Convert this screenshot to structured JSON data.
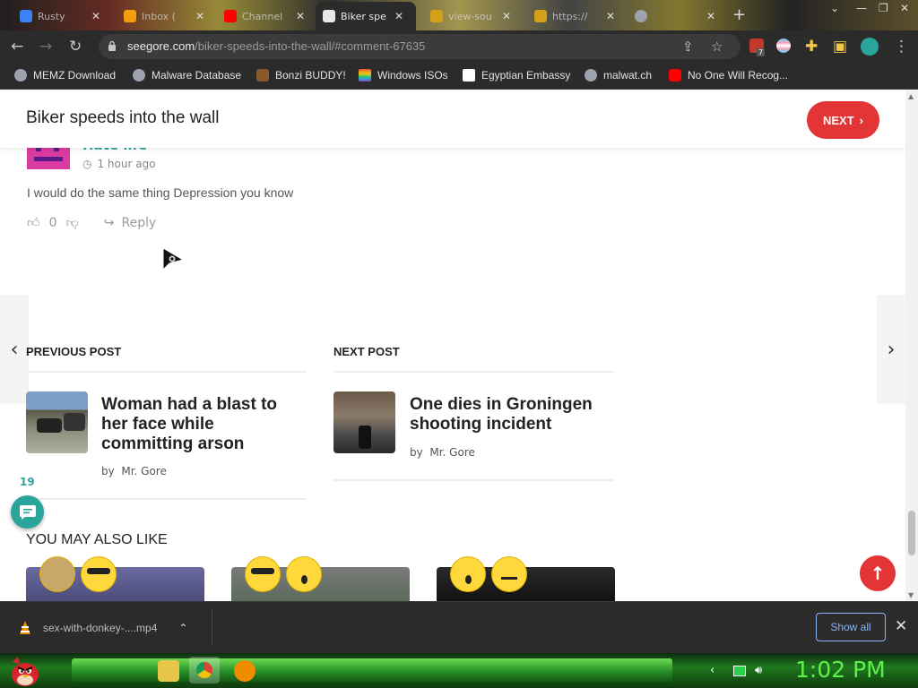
{
  "browser": {
    "tabs": [
      {
        "title": "Rusty",
        "favicon_color": "#3b82f6"
      },
      {
        "title": "Inbox (",
        "favicon_color": "#f59e0b"
      },
      {
        "title": "Channel",
        "favicon_color": "#ff0000"
      },
      {
        "title": "Biker spe",
        "favicon_color": "#e5e7eb",
        "active": true
      },
      {
        "title": "view-sou",
        "favicon_color": "#d4a017"
      },
      {
        "title": "https://",
        "favicon_color": "#d4a017"
      },
      {
        "title": "",
        "favicon_color": "#9ca3af"
      }
    ],
    "new_tab_glyph": "+",
    "url_host": "seegore.com",
    "url_path": "/biker-speeds-into-the-wall/#comment-67635",
    "extension_badge": "7"
  },
  "bookmarks": [
    {
      "label": "MEMZ Download",
      "icon_color": "#9ca3af"
    },
    {
      "label": "Malware Database",
      "icon_color": "#9ca3af"
    },
    {
      "label": "Bonzi BUDDY!",
      "icon_color": "#8b5a2b"
    },
    {
      "label": "Windows ISOs",
      "icon_color": "#e74c3c"
    },
    {
      "label": "Egyptian Embassy",
      "icon_color": "#ffffff"
    },
    {
      "label": "malwat.ch",
      "icon_color": "#9ca3af"
    },
    {
      "label": "No One Will Recog...",
      "icon_color": "#ff0000"
    }
  ],
  "page": {
    "title": "Biker speeds into the wall",
    "next_label": "NEXT",
    "accent": "#e33535",
    "teal": "#2aa59b"
  },
  "comment": {
    "author": "Hate life",
    "time": "1 hour ago",
    "text": "I would do the same thing Depression you know",
    "likes": "0",
    "reply_label": "Reply"
  },
  "post_nav": {
    "previous": {
      "heading": "PREVIOUS POST",
      "title": "Woman had a blast to her face while committing arson",
      "by_label": "by",
      "author": "Mr. Gore"
    },
    "next": {
      "heading": "NEXT POST",
      "title": "One dies in Groningen shooting incident",
      "by_label": "by",
      "author": "Mr. Gore"
    }
  },
  "comment_count": "19",
  "you_may_also_like": "YOU MAY ALSO LIKE",
  "downloads": {
    "filename": "sex-with-donkey-....mp4",
    "show_all": "Show all"
  },
  "taskbar": {
    "clock": "1:02 PM"
  }
}
